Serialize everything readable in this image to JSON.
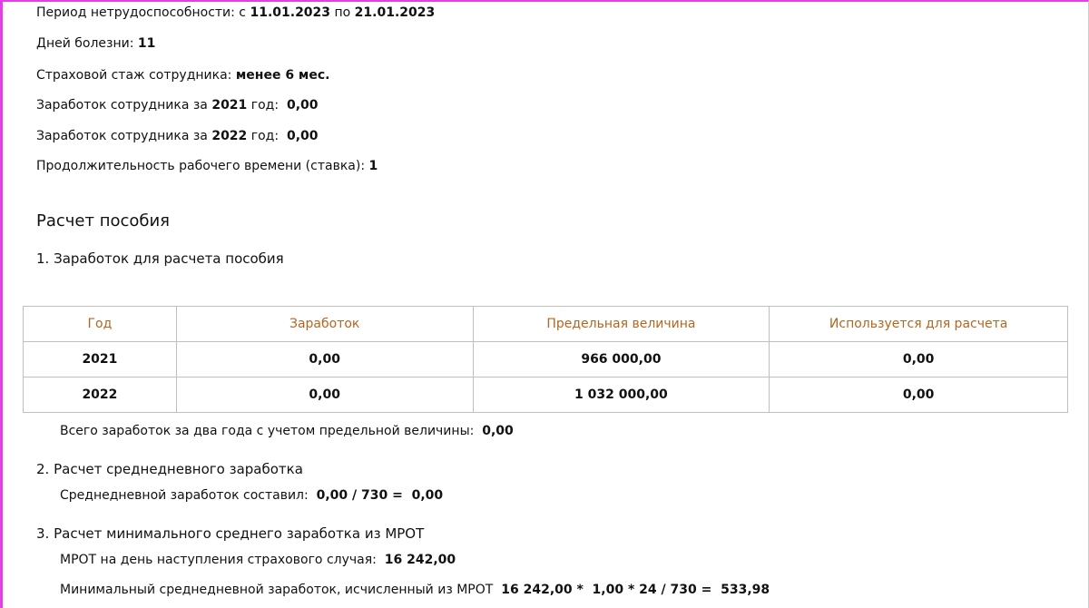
{
  "info": {
    "period_label": "Период нетрудоспособности: с ",
    "period_from": "11.01.2023",
    "period_mid": " по ",
    "period_to": "21.01.2023",
    "days_label": "Дней болезни: ",
    "days_value": "11",
    "stazh_label": "Страховой стаж сотрудника: ",
    "stazh_value": "менее 6 мес.",
    "earn1_label": "Заработок сотрудника за ",
    "earn1_year": "2021",
    "earn1_suffix": " год:  ",
    "earn1_value": "0,00",
    "earn2_label": "Заработок сотрудника за ",
    "earn2_year": "2022",
    "earn2_suffix": " год:  ",
    "earn2_value": "0,00",
    "stavka_label": "Продолжительность рабочего времени (ставка): ",
    "stavka_value": "1"
  },
  "section_title": "Расчет пособия",
  "step1": {
    "title": "1. Заработок для расчета пособия",
    "columns": [
      "Год",
      "Заработок",
      "Предельная величина",
      "Используется для расчета"
    ],
    "rows": [
      [
        "2021",
        "0,00",
        "966 000,00",
        "0,00"
      ],
      [
        "2022",
        "0,00",
        "1 032 000,00",
        "0,00"
      ]
    ],
    "total_label": "Всего заработок за два года с учетом предельной величины:  ",
    "total_value": "0,00"
  },
  "step2": {
    "title": "2. Расчет среднедневного заработка",
    "label": "Среднедневной заработок составил:  ",
    "value": "0,00 / 730 =  0,00"
  },
  "step3": {
    "title": "3. Расчет минимального среднего заработка из МРОТ",
    "mrot_label": "МРОТ на день наступления страхового случая:  ",
    "mrot_value": "16 242,00",
    "min_label": "Минимальный среднедневной заработок, исчисленный из МРОТ  ",
    "min_value": "16 242,00 *  1,00 * 24 / 730 =  533,98"
  }
}
